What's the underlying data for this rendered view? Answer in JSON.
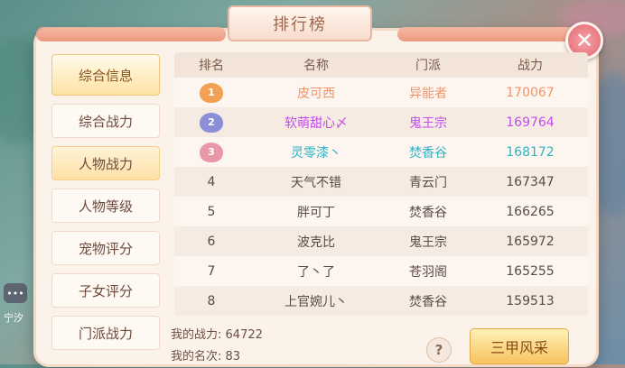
{
  "title": "排行榜",
  "close_glyph": "✕",
  "sidebar": [
    {
      "label": "综合信息",
      "state": "active"
    },
    {
      "label": "综合战力",
      "state": "normal"
    },
    {
      "label": "人物战力",
      "state": "highlight"
    },
    {
      "label": "人物等级",
      "state": "normal"
    },
    {
      "label": "宠物评分",
      "state": "normal"
    },
    {
      "label": "子女评分",
      "state": "normal"
    },
    {
      "label": "门派战力",
      "state": "normal"
    }
  ],
  "table": {
    "headers": [
      "排名",
      "名称",
      "门派",
      "战力"
    ],
    "rows": [
      {
        "rank": "1",
        "name": "皮可西",
        "school": "异能者",
        "power": "170067",
        "color": "#f0946a",
        "badge": "#f2a054"
      },
      {
        "rank": "2",
        "name": "软萌甜心〆",
        "school": "鬼王宗",
        "power": "169764",
        "color": "#c04de8",
        "badge": "#8b8fd8"
      },
      {
        "rank": "3",
        "name": "灵零漆丶",
        "school": "焚香谷",
        "power": "168172",
        "color": "#2fb2c4",
        "badge": "#e998a8"
      },
      {
        "rank": "4",
        "name": "天气不错",
        "school": "青云门",
        "power": "167347",
        "color": "",
        "badge": ""
      },
      {
        "rank": "5",
        "name": "胖可丁",
        "school": "焚香谷",
        "power": "166265",
        "color": "",
        "badge": ""
      },
      {
        "rank": "6",
        "name": "波克比",
        "school": "鬼王宗",
        "power": "165972",
        "color": "",
        "badge": ""
      },
      {
        "rank": "7",
        "name": "了丶了",
        "school": "苍羽阁",
        "power": "165255",
        "color": "",
        "badge": ""
      },
      {
        "rank": "8",
        "name": "上官婉儿丶",
        "school": "焚香谷",
        "power": "159513",
        "color": "",
        "badge": ""
      }
    ]
  },
  "footer": {
    "my_power_label": "我的战力:",
    "my_power": "64722",
    "my_rank_label": "我的名次:",
    "my_rank": "83"
  },
  "help_glyph": "?",
  "action_button": "三甲风采",
  "chat_glyph": "•••",
  "edge_text": "宁汐"
}
